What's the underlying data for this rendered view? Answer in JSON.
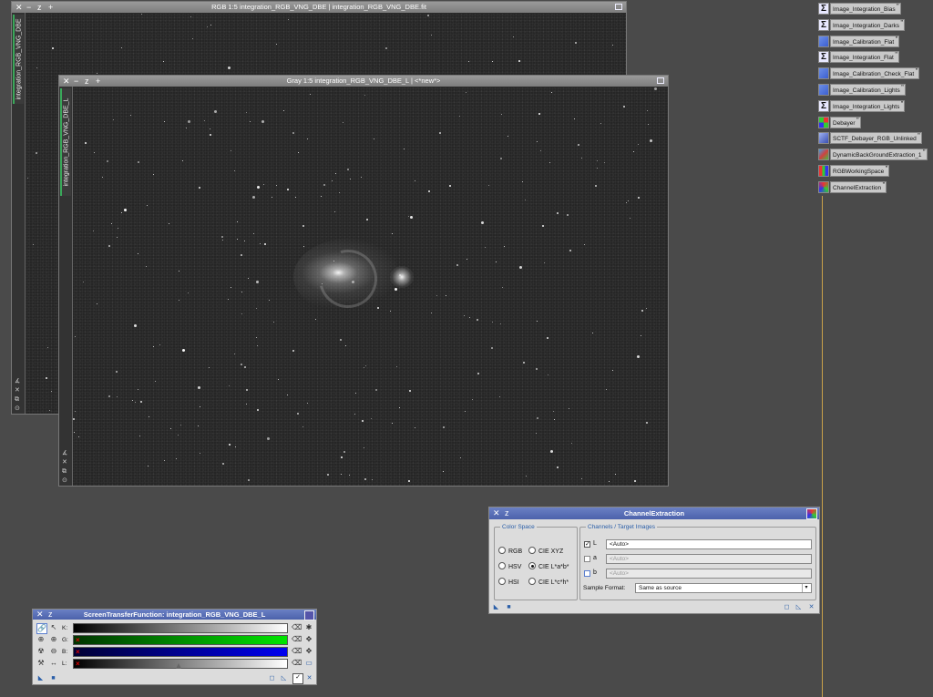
{
  "windows": {
    "rgb": {
      "title": "RGB 1:5 integration_RGB_VNG_DBE | integration_RGB_VNG_DBE.fit",
      "tab": "integration_RGB_VNG_DBE"
    },
    "gray": {
      "title": "Gray 1:5 integration_RGB_VNG_DBE_L | <*new*>",
      "tab": "integration_RGB_VNG_DBE_L"
    }
  },
  "process_icons": [
    {
      "label": "Image_Integration_Bias",
      "icon": "sigma-icon"
    },
    {
      "label": "Image_Integration_Darks",
      "icon": "sigma-icon"
    },
    {
      "label": "Image_Calibration_Flat",
      "icon": "calibration-icon"
    },
    {
      "label": "Image_Integration_Flat",
      "icon": "sigma-icon"
    },
    {
      "label": "Image_Calibration_Check_Flat",
      "icon": "calibration-icon"
    },
    {
      "label": "Image_Calibration_Lights",
      "icon": "calibration-icon"
    },
    {
      "label": "Image_Integration_Lights",
      "icon": "sigma-icon"
    },
    {
      "label": "Debayer",
      "icon": "debayer-icon"
    },
    {
      "label": "SCTF_Debayer_RGB_Unlinked",
      "icon": "stf-icon"
    },
    {
      "label": "DynamicBackGroundExtraction_1",
      "icon": "dbe-icon"
    },
    {
      "label": "RGBWorkingSpace",
      "icon": "rgb-icon"
    },
    {
      "label": "ChannelExtraction",
      "icon": "channel-extraction-icon"
    }
  ],
  "channel_extraction": {
    "title": "ChannelExtraction",
    "color_space_legend": "Color Space",
    "channels_legend": "Channels / Target Images",
    "color_spaces": {
      "rgb": "RGB",
      "ciexyz": "CIE XYZ",
      "hsv": "HSV",
      "cielab": "CIE L*a*b*",
      "hsi": "HSI",
      "cielch": "CIE L*c*h*"
    },
    "selected_color_space": "CIE L*a*b*",
    "channels": [
      {
        "label": "L",
        "checked": true,
        "value": "<Auto>"
      },
      {
        "label": "a",
        "checked": false,
        "value": "<Auto>"
      },
      {
        "label": "b",
        "checked": false,
        "value": "<Auto>"
      }
    ],
    "sample_format_label": "Sample Format:",
    "sample_format_value": "Same as source"
  },
  "stf": {
    "title": "ScreenTransferFunction: integration_RGB_VNG_DBE_L",
    "channels": [
      {
        "label": "K:",
        "color": "#000000"
      },
      {
        "label": "G:",
        "color": "#00c800"
      },
      {
        "label": "B:",
        "color": "#0000e0"
      },
      {
        "label": "L:",
        "color": "#cccccc"
      }
    ]
  }
}
